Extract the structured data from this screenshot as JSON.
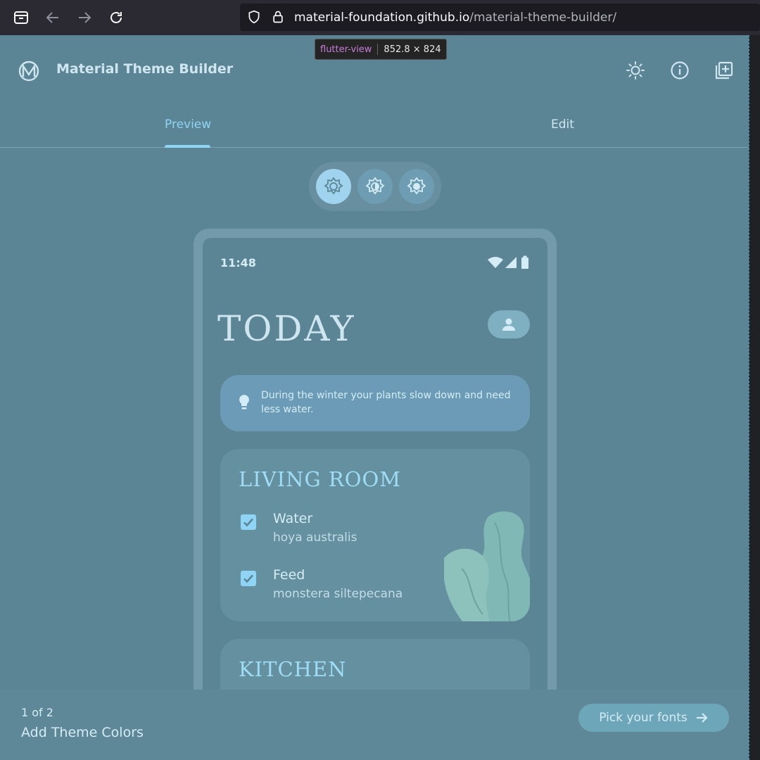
{
  "browser": {
    "url_host": "material-foundation.github.io",
    "url_path": "/material-theme-builder/"
  },
  "inspector_tooltip": {
    "element": "flutter-view",
    "size": "852.8 × 824"
  },
  "header": {
    "title": "Material Theme Builder",
    "icons": [
      "brightness-icon",
      "info-icon",
      "add-library-icon"
    ]
  },
  "tabs": [
    {
      "label": "Preview",
      "active": true
    },
    {
      "label": "Edit",
      "active": false
    }
  ],
  "mode_switch": {
    "options": [
      "light",
      "contrast",
      "dark"
    ],
    "selected": "light"
  },
  "phone": {
    "status_time": "11:48",
    "heading": "TODAY",
    "tip": "During the winter your plants slow down and need less water.",
    "rooms": [
      {
        "title": "LIVING ROOM",
        "tasks": [
          {
            "title": "Water",
            "subtitle": "hoya australis",
            "checked": true
          },
          {
            "title": "Feed",
            "subtitle": "monstera siltepecana",
            "checked": true
          }
        ]
      },
      {
        "title": "KITCHEN",
        "tasks": []
      }
    ]
  },
  "footer": {
    "step": "1 of 2",
    "step_label": "Add Theme Colors",
    "next_button": "Pick your fonts"
  },
  "colors": {
    "surface": "#5b8594",
    "primary": "#8fd4f5",
    "card": "#65909f",
    "tip_container": "#6b9bb6",
    "chrome": "#2b2a33"
  }
}
